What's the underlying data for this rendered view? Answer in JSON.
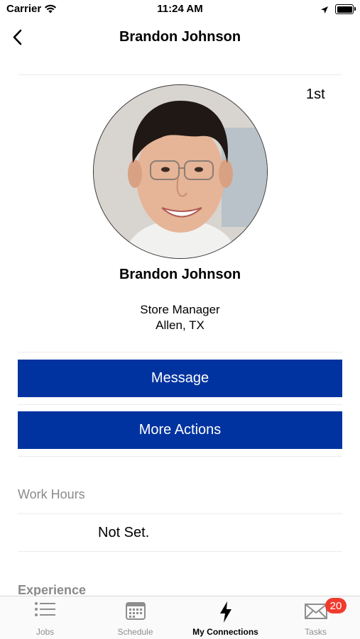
{
  "status_bar": {
    "carrier": "Carrier",
    "time": "11:24 AM"
  },
  "nav": {
    "title": "Brandon Johnson",
    "back_icon": "chevron-left-icon"
  },
  "profile": {
    "connection_degree": "1st",
    "name": "Brandon Johnson",
    "job_title": "Store Manager",
    "location": "Allen, TX"
  },
  "actions": {
    "message_label": "Message",
    "more_actions_label": "More Actions"
  },
  "work_hours": {
    "label": "Work Hours",
    "value": "Not Set."
  },
  "experience": {
    "label": "Experience"
  },
  "tabbar": {
    "tabs": [
      {
        "label": "Jobs",
        "icon": "list-icon"
      },
      {
        "label": "Schedule",
        "icon": "calendar-icon"
      },
      {
        "label": "My Connections",
        "icon": "lightning-icon"
      },
      {
        "label": "Tasks",
        "icon": "mail-icon"
      }
    ],
    "active": "My Connections",
    "tasks_badge": "20"
  },
  "colors": {
    "primary_button": "#0033a0",
    "badge": "#ef3b2d",
    "label_gray": "#8a8a8a"
  }
}
